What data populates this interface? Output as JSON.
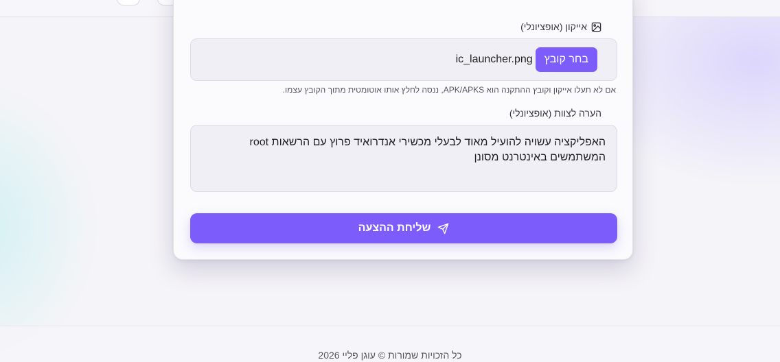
{
  "colors": {
    "accent": "#7c5cfb",
    "field_bg": "#efeff5",
    "page_bg": "#f5f4f8"
  },
  "icon_field": {
    "label": "אייקון (אופציונלי)",
    "icon": "image-icon",
    "choose_button_label": "בחר קובץ",
    "file_name": "ic_launcher.png",
    "hint": "אם לא תעלו אייקון וקובץ ההתקנה הוא APK/APKS, ננסה לחלץ אותו אוטומטית מתוך הקובץ עצמו."
  },
  "note_field": {
    "label": "הערה לצוות (אופציונלי)",
    "value": "האפליקציה עשויה להועיל מאוד לבעלי מכשירי אנדרואיד פרוץ עם הרשאות root המשתמשים באינטרנט מסונן"
  },
  "submit": {
    "label": "שליחת ההצעה",
    "icon": "send-icon"
  },
  "footer": {
    "copyright": "כל הזכויות שמורות © עוגן פליי 2026"
  }
}
